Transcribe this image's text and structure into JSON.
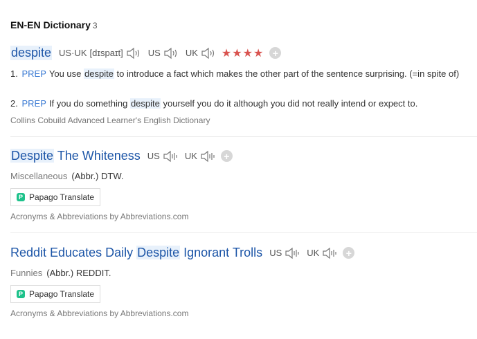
{
  "section": {
    "title": "EN-EN Dictionary",
    "count": "3"
  },
  "entry1": {
    "word": "despite",
    "region_label": "US·UK",
    "phonetic": "[dɪspaɪt]",
    "us_label": "US",
    "uk_label": "UK",
    "stars": "★★★★",
    "definitions": [
      {
        "num": "1.",
        "pos": "PREP",
        "pre": "You use ",
        "hl": "despite",
        "post": " to introduce a fact which makes the other part of the sentence surprising. (=in spite of)"
      },
      {
        "num": "2.",
        "pos": "PREP",
        "pre": "If you do something ",
        "hl": "despite",
        "post": " yourself you do it although you did not really intend or expect to."
      }
    ],
    "source": "Collins Cobuild Advanced Learner's English Dictionary"
  },
  "entry2": {
    "word_hl": "Despite",
    "word_rest": " The Whiteness",
    "us_label": "US",
    "uk_label": "UK",
    "category": "Miscellaneous",
    "abbr": "(Abbr.) DTW.",
    "papago": "Papago Translate",
    "source": "Acronyms & Abbreviations by Abbreviations.com"
  },
  "entry3": {
    "word_pre": "Reddit Educates Daily ",
    "word_hl": "Despite",
    "word_post": " Ignorant Trolls",
    "us_label": "US",
    "uk_label": "UK",
    "category": "Funnies",
    "abbr": "(Abbr.) REDDIT.",
    "papago": "Papago Translate",
    "source": "Acronyms & Abbreviations by Abbreviations.com"
  }
}
